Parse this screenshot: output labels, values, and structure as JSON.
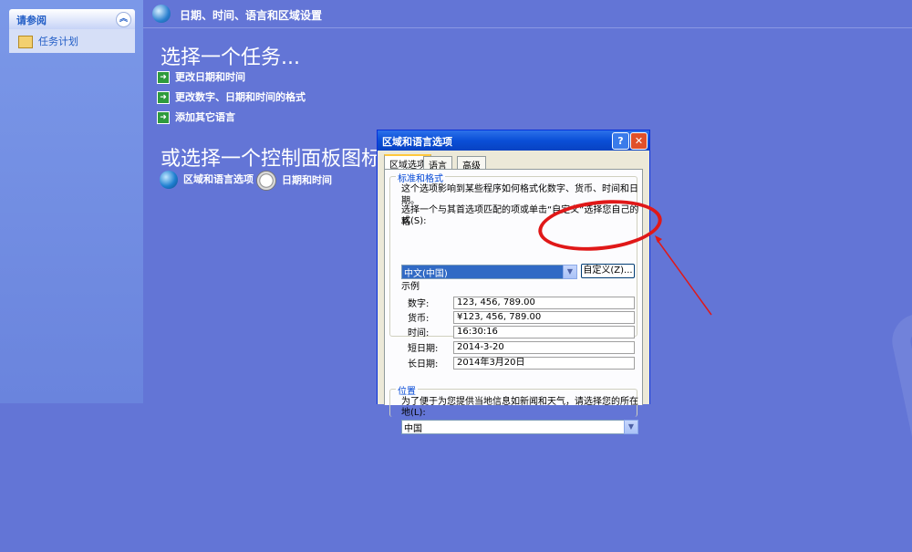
{
  "left_pane": {
    "see_also_title": "请参阅",
    "collapse_glyph": "︽",
    "task_item": "任务计划"
  },
  "header": {
    "title": "日期、时间、语言和区域设置"
  },
  "main": {
    "pick_task": "选择一个任务...",
    "tasks": [
      "更改日期和时间",
      "更改数字、日期和时间的格式",
      "添加其它语言"
    ],
    "pick_icon": "或选择一个控制面板图标",
    "icons": [
      "区域和语言选项",
      "日期和时间"
    ]
  },
  "dialog": {
    "title": "区域和语言选项",
    "help": "?",
    "close": "✕",
    "tabs": [
      "区域选项",
      "语言",
      "高级"
    ],
    "standards": {
      "label": "标准和格式",
      "description": "这个选项影响到某些程序如何格式化数字、货币、时间和日期。",
      "instruction_line1": "选择一个与其首选项匹配的项或单击“自定义”选择您自己的格",
      "instruction_line2": "式(S):",
      "selected_locale": "中文(中国)",
      "customize_button": "自定义(Z)...",
      "samples_label": "示例",
      "samples": [
        {
          "label": "数字:",
          "value": "123, 456, 789.00"
        },
        {
          "label": "货币:",
          "value": "¥123, 456, 789.00"
        },
        {
          "label": "时间:",
          "value": "16:30:16"
        },
        {
          "label": "短日期:",
          "value": "2014-3-20"
        },
        {
          "label": "长日期:",
          "value": "2014年3月20日"
        }
      ]
    },
    "location": {
      "label": "位置",
      "description_line1": "为了便于为您提供当地信息如新闻和天气，请选择您的所在",
      "description_line2": "地(L):",
      "selected": "中国"
    }
  },
  "colors": {
    "background": "#6375d6",
    "annotation": "#e01818"
  }
}
